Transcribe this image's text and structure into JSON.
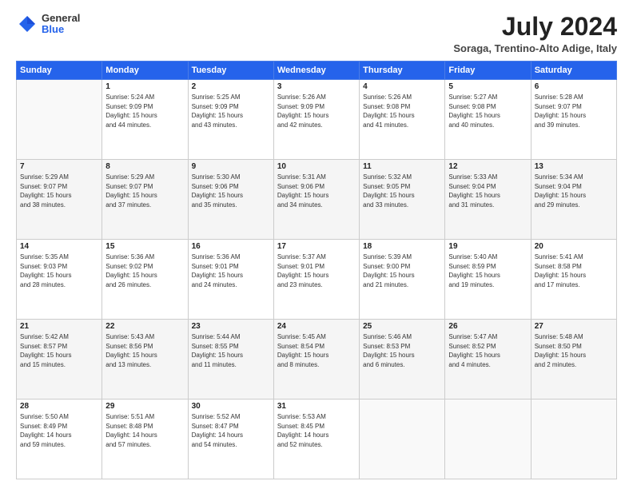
{
  "logo": {
    "general": "General",
    "blue": "Blue"
  },
  "title": "July 2024",
  "subtitle": "Soraga, Trentino-Alto Adige, Italy",
  "calendar": {
    "headers": [
      "Sunday",
      "Monday",
      "Tuesday",
      "Wednesday",
      "Thursday",
      "Friday",
      "Saturday"
    ],
    "weeks": [
      [
        {
          "num": "",
          "info": ""
        },
        {
          "num": "1",
          "info": "Sunrise: 5:24 AM\nSunset: 9:09 PM\nDaylight: 15 hours\nand 44 minutes."
        },
        {
          "num": "2",
          "info": "Sunrise: 5:25 AM\nSunset: 9:09 PM\nDaylight: 15 hours\nand 43 minutes."
        },
        {
          "num": "3",
          "info": "Sunrise: 5:26 AM\nSunset: 9:09 PM\nDaylight: 15 hours\nand 42 minutes."
        },
        {
          "num": "4",
          "info": "Sunrise: 5:26 AM\nSunset: 9:08 PM\nDaylight: 15 hours\nand 41 minutes."
        },
        {
          "num": "5",
          "info": "Sunrise: 5:27 AM\nSunset: 9:08 PM\nDaylight: 15 hours\nand 40 minutes."
        },
        {
          "num": "6",
          "info": "Sunrise: 5:28 AM\nSunset: 9:07 PM\nDaylight: 15 hours\nand 39 minutes."
        }
      ],
      [
        {
          "num": "7",
          "info": "Sunrise: 5:29 AM\nSunset: 9:07 PM\nDaylight: 15 hours\nand 38 minutes."
        },
        {
          "num": "8",
          "info": "Sunrise: 5:29 AM\nSunset: 9:07 PM\nDaylight: 15 hours\nand 37 minutes."
        },
        {
          "num": "9",
          "info": "Sunrise: 5:30 AM\nSunset: 9:06 PM\nDaylight: 15 hours\nand 35 minutes."
        },
        {
          "num": "10",
          "info": "Sunrise: 5:31 AM\nSunset: 9:06 PM\nDaylight: 15 hours\nand 34 minutes."
        },
        {
          "num": "11",
          "info": "Sunrise: 5:32 AM\nSunset: 9:05 PM\nDaylight: 15 hours\nand 33 minutes."
        },
        {
          "num": "12",
          "info": "Sunrise: 5:33 AM\nSunset: 9:04 PM\nDaylight: 15 hours\nand 31 minutes."
        },
        {
          "num": "13",
          "info": "Sunrise: 5:34 AM\nSunset: 9:04 PM\nDaylight: 15 hours\nand 29 minutes."
        }
      ],
      [
        {
          "num": "14",
          "info": "Sunrise: 5:35 AM\nSunset: 9:03 PM\nDaylight: 15 hours\nand 28 minutes."
        },
        {
          "num": "15",
          "info": "Sunrise: 5:36 AM\nSunset: 9:02 PM\nDaylight: 15 hours\nand 26 minutes."
        },
        {
          "num": "16",
          "info": "Sunrise: 5:36 AM\nSunset: 9:01 PM\nDaylight: 15 hours\nand 24 minutes."
        },
        {
          "num": "17",
          "info": "Sunrise: 5:37 AM\nSunset: 9:01 PM\nDaylight: 15 hours\nand 23 minutes."
        },
        {
          "num": "18",
          "info": "Sunrise: 5:39 AM\nSunset: 9:00 PM\nDaylight: 15 hours\nand 21 minutes."
        },
        {
          "num": "19",
          "info": "Sunrise: 5:40 AM\nSunset: 8:59 PM\nDaylight: 15 hours\nand 19 minutes."
        },
        {
          "num": "20",
          "info": "Sunrise: 5:41 AM\nSunset: 8:58 PM\nDaylight: 15 hours\nand 17 minutes."
        }
      ],
      [
        {
          "num": "21",
          "info": "Sunrise: 5:42 AM\nSunset: 8:57 PM\nDaylight: 15 hours\nand 15 minutes."
        },
        {
          "num": "22",
          "info": "Sunrise: 5:43 AM\nSunset: 8:56 PM\nDaylight: 15 hours\nand 13 minutes."
        },
        {
          "num": "23",
          "info": "Sunrise: 5:44 AM\nSunset: 8:55 PM\nDaylight: 15 hours\nand 11 minutes."
        },
        {
          "num": "24",
          "info": "Sunrise: 5:45 AM\nSunset: 8:54 PM\nDaylight: 15 hours\nand 8 minutes."
        },
        {
          "num": "25",
          "info": "Sunrise: 5:46 AM\nSunset: 8:53 PM\nDaylight: 15 hours\nand 6 minutes."
        },
        {
          "num": "26",
          "info": "Sunrise: 5:47 AM\nSunset: 8:52 PM\nDaylight: 15 hours\nand 4 minutes."
        },
        {
          "num": "27",
          "info": "Sunrise: 5:48 AM\nSunset: 8:50 PM\nDaylight: 15 hours\nand 2 minutes."
        }
      ],
      [
        {
          "num": "28",
          "info": "Sunrise: 5:50 AM\nSunset: 8:49 PM\nDaylight: 14 hours\nand 59 minutes."
        },
        {
          "num": "29",
          "info": "Sunrise: 5:51 AM\nSunset: 8:48 PM\nDaylight: 14 hours\nand 57 minutes."
        },
        {
          "num": "30",
          "info": "Sunrise: 5:52 AM\nSunset: 8:47 PM\nDaylight: 14 hours\nand 54 minutes."
        },
        {
          "num": "31",
          "info": "Sunrise: 5:53 AM\nSunset: 8:45 PM\nDaylight: 14 hours\nand 52 minutes."
        },
        {
          "num": "",
          "info": ""
        },
        {
          "num": "",
          "info": ""
        },
        {
          "num": "",
          "info": ""
        }
      ]
    ]
  }
}
